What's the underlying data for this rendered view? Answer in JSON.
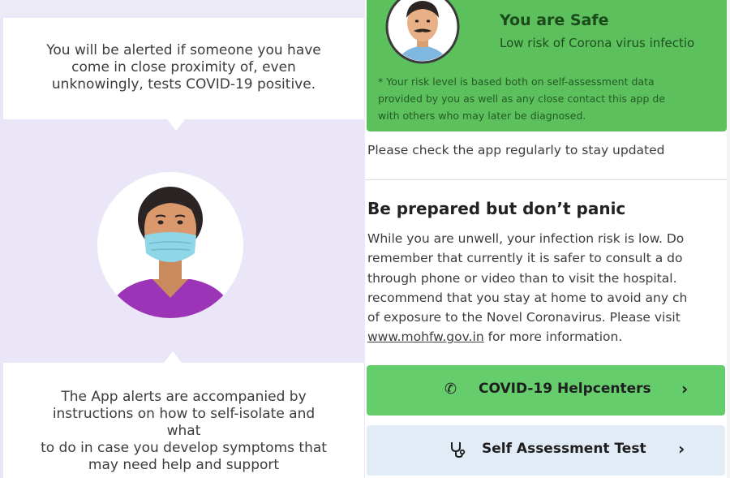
{
  "left_panel": {
    "bubble1_lines": [
      "You will be alerted if someone you have",
      "come in close proximity of, even",
      "unknowingly, tests COVID-19 positive."
    ],
    "bubble2_lines": [
      "The App alerts are accompanied by",
      "instructions on how to self-isolate and",
      "what",
      "to do in case you develop symptoms that",
      "may need help and support"
    ],
    "avatar_icon": "masked-woman-icon"
  },
  "right_panel": {
    "status": {
      "title": "You are Safe",
      "subtitle": "Low risk of Corona virus infectio",
      "note_lines": [
        "* Your risk level is based both on self-assessment data",
        "provided by you as well as any close contact this app de",
        "with others who may later be diagnosed."
      ],
      "avatar_icon": "man-avatar-icon",
      "color": "#5cc15d"
    },
    "check_text": "Please check the app regularly to stay updated",
    "prepared": {
      "heading": "Be prepared but don’t panic",
      "lines": [
        "While you are unwell, your infection risk is low. Do",
        "remember that currently it is safer to consult a do",
        "through phone or video than to visit the hospital.",
        "recommend that you stay at home to avoid any ch",
        "of exposure to the Novel Coronavirus. Please visit"
      ],
      "link_text": "www.mohfw.gov.in",
      "link_suffix": " for more information."
    },
    "buttons": {
      "helpcenters": {
        "label": "COVID-19 Helpcenters",
        "icon": "phone-icon",
        "color": "#66cd6d"
      },
      "self_test": {
        "label": "Self Assessment Test",
        "icon": "stethoscope-icon",
        "color": "#e2ecf7"
      }
    }
  }
}
